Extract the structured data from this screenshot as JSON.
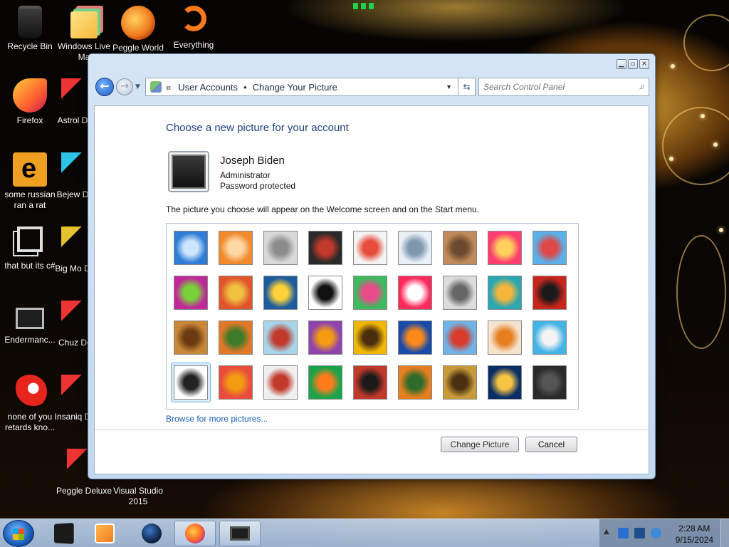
{
  "desktop": {
    "icons": [
      {
        "label": "Recycle Bin"
      },
      {
        "label": "Windows Live Ma"
      },
      {
        "label": "Peggle World"
      },
      {
        "label": "Everything"
      },
      {
        "label": "Firefox"
      },
      {
        "label": "Astrol Delu"
      },
      {
        "label": "some russian ran a rat"
      },
      {
        "label": "Bejew Delu"
      },
      {
        "label": "that but its c#"
      },
      {
        "label": "Big Mo Delu"
      },
      {
        "label": "Endermanc..."
      },
      {
        "label": "Chuz Delu"
      },
      {
        "label": "none of you retards kno..."
      },
      {
        "label": "Insaniq Delu"
      },
      {
        "label": "Peggle Deluxe"
      },
      {
        "label": "Visual Studio 2015"
      }
    ]
  },
  "window": {
    "breadcrumb": {
      "part1": "User Accounts",
      "separator": "•",
      "part2": "Change Your Picture"
    },
    "search_placeholder": "Search Control Panel",
    "heading": "Choose a new picture for your account",
    "user": {
      "name": "Joseph Biden",
      "role": "Administrator",
      "password_status": "Password protected"
    },
    "description": "The picture you choose will appear on the Welcome screen and on the Start menu.",
    "pictures": [
      {
        "name": "roller-coaster",
        "colors": [
          "#2e7dd7",
          "#cfe6ff"
        ]
      },
      {
        "name": "starfish",
        "colors": [
          "#f08a2c",
          "#ffd8a8"
        ]
      },
      {
        "name": "robot-toy",
        "colors": [
          "#d9d9d9",
          "#8c8c8c"
        ]
      },
      {
        "name": "turntable",
        "colors": [
          "#2a2a2a",
          "#c0392b"
        ]
      },
      {
        "name": "lucky-cat",
        "colors": [
          "#f4f4f4",
          "#e74c3c"
        ]
      },
      {
        "name": "gyroscope",
        "colors": [
          "#e9f1f7",
          "#7f98ad"
        ]
      },
      {
        "name": "kitten",
        "colors": [
          "#c08a5a",
          "#6b4a2e"
        ]
      },
      {
        "name": "gerbera-flower",
        "colors": [
          "#ff3d6e",
          "#ffd15c"
        ]
      },
      {
        "name": "ferris-wheel",
        "colors": [
          "#5ab0e8",
          "#e04848"
        ]
      },
      {
        "name": "bowling-ball",
        "colors": [
          "#c0289a",
          "#7ad13a"
        ]
      },
      {
        "name": "fabric-weave",
        "colors": [
          "#e0552b",
          "#f0c040"
        ]
      },
      {
        "name": "yellow-leaf",
        "colors": [
          "#1d5c9c",
          "#ffd23a"
        ]
      },
      {
        "name": "border-collie",
        "colors": [
          "#ffffff",
          "#111111"
        ]
      },
      {
        "name": "crayons",
        "colors": [
          "#3dbb5e",
          "#e94b8a"
        ]
      },
      {
        "name": "paper-star",
        "colors": [
          "#ff2a5c",
          "#ffffff"
        ]
      },
      {
        "name": "jacks",
        "colors": [
          "#dcdcdc",
          "#666666"
        ]
      },
      {
        "name": "stairs",
        "colors": [
          "#2ba6b3",
          "#f6b53a"
        ]
      },
      {
        "name": "paper-crane",
        "colors": [
          "#c7261c",
          "#1a1a1a"
        ]
      },
      {
        "name": "guitar",
        "colors": [
          "#c88838",
          "#6b3a12"
        ]
      },
      {
        "name": "pomeranian",
        "colors": [
          "#e07828",
          "#3d7a2a"
        ]
      },
      {
        "name": "tin-robot",
        "colors": [
          "#a8d4e8",
          "#c0392b"
        ]
      },
      {
        "name": "colorful-cloth",
        "colors": [
          "#8e44ad",
          "#f39c12"
        ]
      },
      {
        "name": "sunflower",
        "colors": [
          "#f2b705",
          "#4a2d0f"
        ]
      },
      {
        "name": "tropical-fish",
        "colors": [
          "#1b4ba8",
          "#ff8a1a"
        ]
      },
      {
        "name": "hot-air-balloon",
        "colors": [
          "#6fb3e8",
          "#d83b2a"
        ]
      },
      {
        "name": "clay-figure",
        "colors": [
          "#f6e3cc",
          "#e67e22"
        ]
      },
      {
        "name": "sailboat",
        "colors": [
          "#43b3e6",
          "#f4f4f4"
        ]
      },
      {
        "name": "soccer-ball",
        "colors": [
          "#ffffff",
          "#222222"
        ]
      },
      {
        "name": "striped-fabric",
        "colors": [
          "#e84c3d",
          "#f39c12"
        ]
      },
      {
        "name": "marbles",
        "colors": [
          "#f0f0f0",
          "#c0392b"
        ]
      },
      {
        "name": "green-window",
        "colors": [
          "#1aa34a",
          "#ff7a1a"
        ]
      },
      {
        "name": "woven-pattern",
        "colors": [
          "#c0392b",
          "#1a1a1a"
        ]
      },
      {
        "name": "butterfly",
        "colors": [
          "#e67e22",
          "#2f6b2a"
        ]
      },
      {
        "name": "wicker-basket",
        "colors": [
          "#c89a3a",
          "#4a3010"
        ]
      },
      {
        "name": "lighthouse",
        "colors": [
          "#0c2e66",
          "#f6c343"
        ]
      },
      {
        "name": "monitor-picture",
        "colors": [
          "#2a2a2a",
          "#555555"
        ]
      }
    ],
    "selected_index": 27,
    "browse_link": "Browse for more pictures...",
    "change_button": "Change Picture",
    "cancel_button": "Cancel"
  },
  "taskbar": {
    "time": "2:28 AM",
    "date": "9/15/2024"
  }
}
